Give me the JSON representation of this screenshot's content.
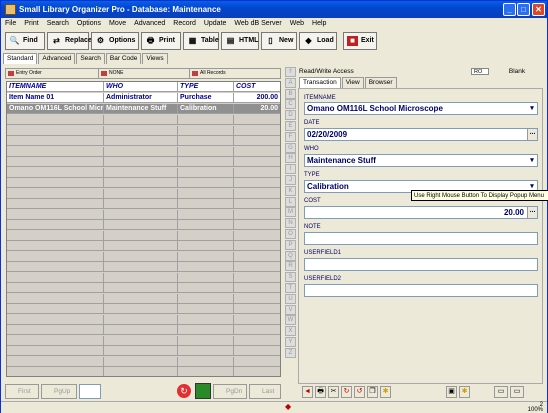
{
  "window": {
    "title": "Small Library Organizer Pro - Database: Maintenance"
  },
  "menu": [
    "File",
    "Print",
    "Search",
    "Options",
    "Move",
    "Advanced",
    "Record",
    "Update",
    "Web dB Server",
    "Web",
    "Help"
  ],
  "toolbar": {
    "find": "Find",
    "replace": "Replace",
    "options": "Options",
    "print": "Print",
    "table": "Table",
    "html": "HTML",
    "new": "New",
    "load": "Load",
    "exit": "Exit"
  },
  "view_tabs": [
    "Standard",
    "Advanced",
    "Search",
    "Bar Code",
    "Views"
  ],
  "sort": {
    "entry_order": "Entry Order",
    "none": "NONE",
    "all_records": "All Records"
  },
  "grid": {
    "columns": [
      "ITEMNAME",
      "WHO",
      "TYPE",
      "COST"
    ],
    "rows": [
      [
        "Item Name 01",
        "Administrator",
        "Purchase",
        "200.00"
      ],
      [
        "Omano OM116L School Microscope",
        "Maintenance Stuff",
        "Calibration",
        "20.00"
      ]
    ]
  },
  "nav": {
    "first": "First",
    "pgup": "PgUp",
    "pgdn": "PgDn",
    "last": "Last"
  },
  "letters": [
    "A",
    "B",
    "C",
    "D",
    "E",
    "F",
    "G",
    "H",
    "I",
    "J",
    "K",
    "L",
    "M",
    "N",
    "O",
    "P",
    "Q",
    "R",
    "S",
    "T",
    "U",
    "V",
    "W",
    "X",
    "Y",
    "Z"
  ],
  "right": {
    "access": "Read/Write Access",
    "ro": "RO",
    "blank": "Blank",
    "tabs": [
      "Transaction",
      "View",
      "Browser"
    ],
    "fields": {
      "itemname_label": "ITEMNAME",
      "itemname": "Omano OM116L School Microscope",
      "date_label": "DATE",
      "date": "02/20/2009",
      "who_label": "WHO",
      "who": "Maintenance Stuff",
      "type_label": "TYPE",
      "type": "Calibration",
      "cost_label": "COST",
      "cost": "20.00",
      "note_label": "NOTE",
      "userfield1_label": "USERFIELD1",
      "userfield2_label": "USERFIELD2"
    },
    "tooltip": "Use Right Mouse Button To Display Popup Menu"
  },
  "status": {
    "count": "2",
    "zoom": "100%"
  }
}
